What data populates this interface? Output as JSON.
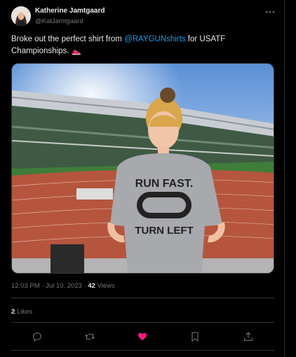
{
  "tweet": {
    "author_name": "Katherine Jamtgaard",
    "author_handle": "@KatJamtgaard",
    "text_before": "Broke out the perfect shirt from ",
    "mention": "@RAYGUNshirts",
    "text_after": " for USATF Championships.",
    "shirt_text_top": "RUN FAST.",
    "shirt_text_bottom": "TURN LEFT",
    "time": "12:03 PM",
    "date": "Jul 10, 2023",
    "views_count": "42",
    "views_label": "Views",
    "likes_count": "2",
    "likes_label": "Likes",
    "sep": "·"
  },
  "icons": {
    "more": "more-icon",
    "reply": "reply-icon",
    "retweet": "retweet-icon",
    "like": "heart-filled-icon",
    "bookmark": "bookmark-icon",
    "share": "share-icon"
  },
  "colors": {
    "accent": "#1d9bf0",
    "like": "#f91880",
    "muted": "#71767b",
    "background": "#000000"
  }
}
